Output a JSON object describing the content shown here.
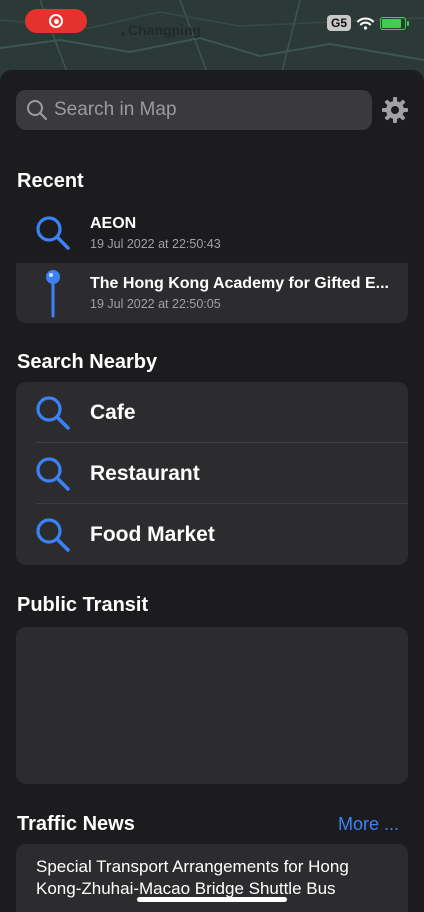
{
  "map": {
    "place_label": "Changping"
  },
  "status_bar": {
    "network": "G5"
  },
  "search": {
    "placeholder": "Search in Map"
  },
  "recent": {
    "title": "Recent",
    "items": [
      {
        "title": "AEON",
        "time": "19 Jul 2022 at 22:50:43",
        "icon": "search-icon"
      },
      {
        "title": "The Hong Kong Academy for Gifted E...",
        "time": "19 Jul 2022 at 22:50:05",
        "icon": "map-pin-icon"
      }
    ]
  },
  "nearby": {
    "title": "Search Nearby",
    "items": [
      {
        "label": "Cafe"
      },
      {
        "label": "Restaurant"
      },
      {
        "label": "Food Market"
      }
    ]
  },
  "transit": {
    "title": "Public Transit"
  },
  "traffic": {
    "title": "Traffic News",
    "more_label": "More ...",
    "headline": "Special Transport Arrangements for Hong Kong-Zhuhai-Macao Bridge Shuttle Bus"
  },
  "colors": {
    "accent": "#3b82f6",
    "background": "#1c1c1e",
    "card": "#2c2c2e"
  }
}
